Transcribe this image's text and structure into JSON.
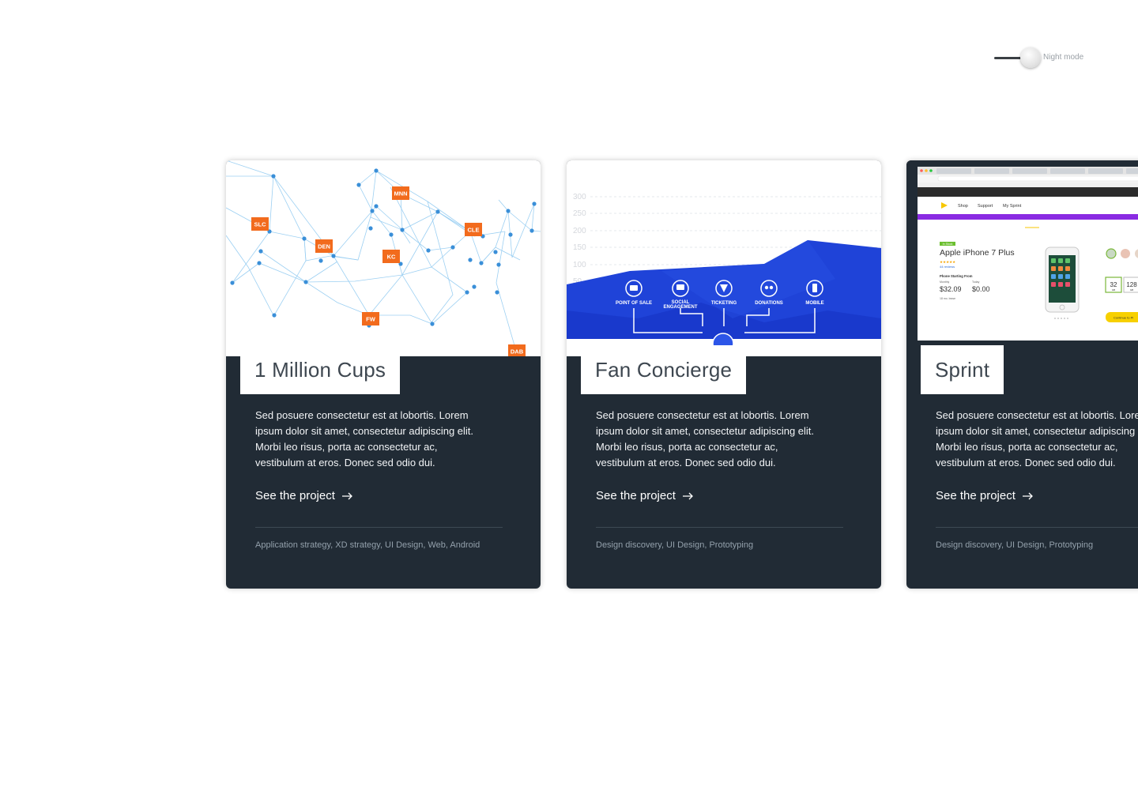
{
  "night_mode": {
    "label": "Night mode",
    "enabled": false
  },
  "cards": [
    {
      "title": "1 Million Cups",
      "description_lines": [
        "Sed posuere consectetur est at lobortis. Lorem",
        "ipsum dolor sit amet, consectetur adipiscing elit.",
        "Morbi leo risus, porta ac consectetur ac,",
        "vestibulum at eros. Donec sed odio dui."
      ],
      "link_label": "See the project",
      "tags": "Application strategy, XD strategy, UI Design, Web, Android",
      "image": {
        "city_labels": [
          "MNN",
          "SLC",
          "CLE",
          "DEN",
          "KC",
          "FW",
          "DAB"
        ],
        "accent_color": "#f26b1d",
        "network_color": "#5aa9e6"
      }
    },
    {
      "title": "Fan Concierge",
      "description_lines": [
        "Sed posuere consectetur est at lobortis. Lorem",
        "ipsum dolor sit amet, consectetur adipiscing elit.",
        "Morbi leo risus, porta ac consectetur ac,",
        "vestibulum at eros. Donec sed odio dui."
      ],
      "link_label": "See the project",
      "tags": "Design discovery, UI Design, Prototyping",
      "image": {
        "axis_ticks": [
          "300",
          "250",
          "200",
          "150",
          "100",
          "50"
        ],
        "features": [
          "POINT OF SALE",
          "SOCIAL",
          "ENGAGEMENT",
          "TICKETING",
          "DONATIONS",
          "MOBILE"
        ],
        "accent_color": "#1d3fd6"
      }
    },
    {
      "title": "Sprint",
      "description_lines": [
        "Sed posuere consectetur est at lobortis. Lorem",
        "ipsum dolor sit amet, consectetur adipiscing elit.",
        "Morbi leo risus, porta ac consectetur ac,",
        "vestibulum at eros. Donec sed odio dui."
      ],
      "link_label": "See the project",
      "tags": "Design discovery, UI Design, Prototyping",
      "image": {
        "nav_items": [
          "Shop",
          "Support",
          "My Sprint"
        ],
        "product_name": "Apple iPhone 7 Plus",
        "badge": "In Stock",
        "reviews": "44 reviews",
        "price_heading": "Phone Starting From",
        "price_monthly_label": "Monthly",
        "price_today_label": "Today",
        "price_monthly": "$32.09",
        "price_today": "$0.00",
        "price_note": "18 mo. lease",
        "storage_options": [
          "32",
          "128"
        ],
        "storage_unit": "GB",
        "cta": "Continue to Pl",
        "accent_color": "#8a2be2"
      }
    }
  ]
}
